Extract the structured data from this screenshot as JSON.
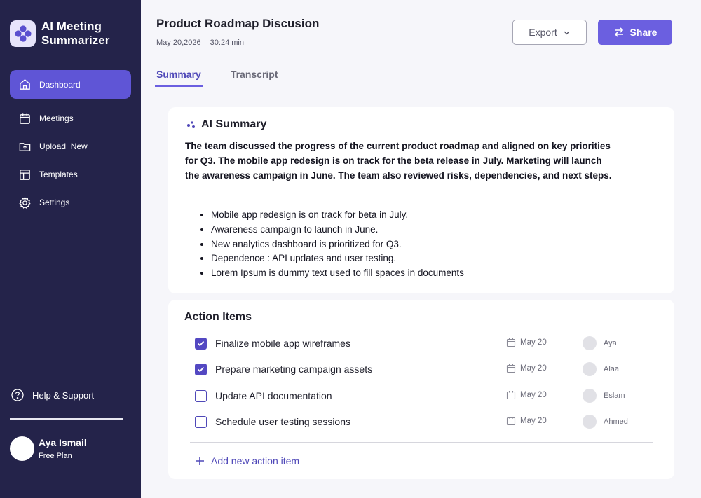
{
  "app": {
    "name": "AI Meeting Summarizer"
  },
  "sidebar": {
    "items": [
      {
        "label": "Dashboard",
        "icon": "home-icon",
        "active": true
      },
      {
        "label": "Meetings",
        "icon": "calendar-icon",
        "active": false
      },
      {
        "label": "Upload  New",
        "icon": "upload-folder-icon",
        "active": false
      },
      {
        "label": "Templates",
        "icon": "templates-icon",
        "active": false
      },
      {
        "label": "Settings",
        "icon": "gear-icon",
        "active": false
      }
    ],
    "help_label": "Help & Support",
    "user": {
      "name": "Aya Ismail",
      "plan": "Free Plan"
    }
  },
  "header": {
    "title": "Product Roadmap Discusion",
    "date": "May 20,2026",
    "duration": "30:24 min",
    "export_label": "Export",
    "share_label": "Share"
  },
  "tabs": [
    {
      "label": "Summary",
      "active": true
    },
    {
      "label": "Transcript",
      "active": false
    }
  ],
  "summary": {
    "heading": "AI Summary",
    "text": "The team discussed the progress of the current product roadmap and aligned on key priorities for Q3. The mobile app redesign is on track for the beta release in July. Marketing will launch the awareness campaign in June. The team also reviewed risks, dependencies, and next steps.",
    "bullets": [
      "Mobile app redesign is on track for beta in July.",
      "Awareness campaign to launch in June.",
      "New analytics dashboard is prioritized for Q3.",
      "Dependence : API updates and user testing.",
      "Lorem Ipsum is dummy text used to fill spaces in documents"
    ]
  },
  "actions": {
    "heading": "Action Items",
    "items": [
      {
        "label": "Finalize mobile app wireframes",
        "done": true,
        "date": "May 20",
        "assignee": "Aya"
      },
      {
        "label": "Prepare marketing campaign assets",
        "done": true,
        "date": "May 20",
        "assignee": "Alaa"
      },
      {
        "label": "Update API documentation",
        "done": false,
        "date": "May 20",
        "assignee": "Eslam"
      },
      {
        "label": "Schedule user testing sessions",
        "done": false,
        "date": "May 20",
        "assignee": "Ahmed"
      }
    ],
    "add_label": "Add new action item"
  },
  "colors": {
    "sidebar_bg": "#24234a",
    "accent": "#6b5fe0",
    "page_bg": "#f6f6fa"
  }
}
